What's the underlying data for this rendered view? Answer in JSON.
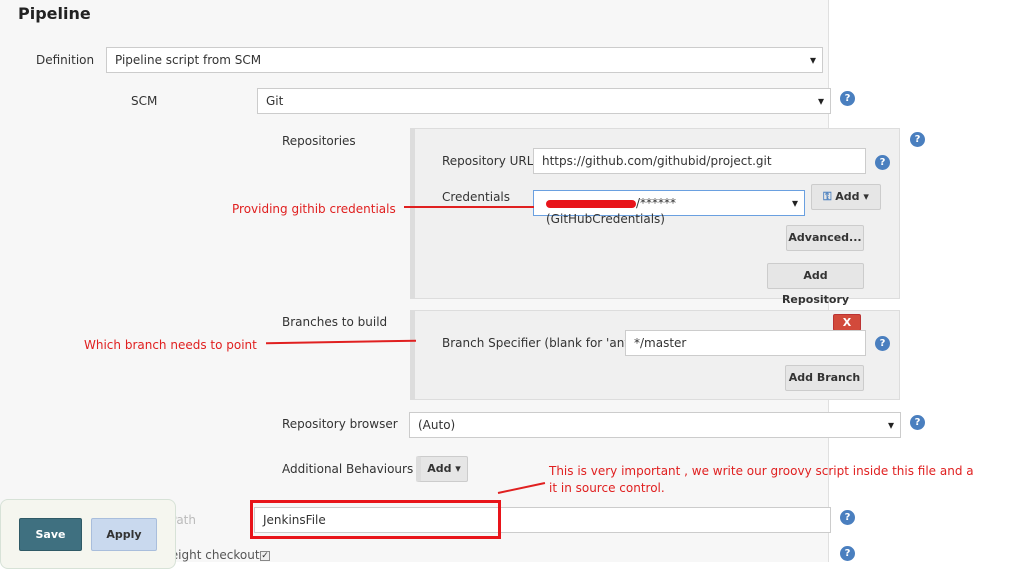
{
  "section_title": "Pipeline",
  "definition": {
    "label": "Definition",
    "value": "Pipeline script from SCM"
  },
  "scm": {
    "label": "SCM",
    "value": "Git"
  },
  "repositories": {
    "label": "Repositories",
    "url_label": "Repository URL",
    "url_value": "https://github.com/githubid/project.git",
    "credentials_label": "Credentials",
    "credentials_value": "/****** (GitHubCredentials)",
    "add_label": "Add",
    "advanced_label": "Advanced...",
    "add_repository_label": "Add Repository"
  },
  "branches": {
    "label": "Branches to build",
    "specifier_label": "Branch Specifier (blank for 'any')",
    "specifier_value": "*/master",
    "delete_label": "X",
    "add_branch_label": "Add Branch"
  },
  "repo_browser": {
    "label": "Repository browser",
    "value": "(Auto)"
  },
  "additional": {
    "label": "Additional Behaviours",
    "add_label": "Add"
  },
  "script_path": {
    "label": "Script Path",
    "value": "JenkinsFile"
  },
  "lightweight": {
    "label": "Lightweight checkout",
    "checked": true
  },
  "buttons": {
    "save": "Save",
    "apply": "Apply"
  },
  "help_icon": "?",
  "annotations": {
    "credentials": "Providing githib credentials",
    "branch": "Which branch needs to point",
    "script_line1": "This is very important , we write our groovy script inside this file and a",
    "script_line2": "it in source control."
  },
  "colors": {
    "annotation": "#e02020",
    "save": "#3f7080",
    "help": "#4a7fbf"
  }
}
